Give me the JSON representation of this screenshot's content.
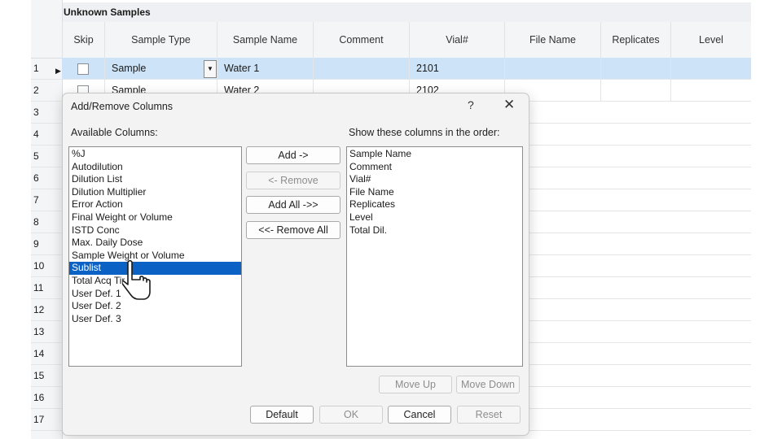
{
  "grid": {
    "title": "Unknown Samples",
    "columns": [
      "Skip",
      "Sample Type",
      "Sample Name",
      "Comment",
      "Vial#",
      "File Name",
      "Replicates",
      "Level"
    ],
    "row_numbers": [
      "1",
      "2",
      "3",
      "4",
      "5",
      "6",
      "7",
      "8",
      "9",
      "10",
      "11",
      "12",
      "13",
      "14",
      "15",
      "16",
      "17"
    ],
    "rows": [
      {
        "sample_type": "Sample",
        "sample_name": "Water 1",
        "vial": "2101"
      },
      {
        "sample_type": "Sample",
        "sample_name": "Water 2",
        "vial": "2102"
      }
    ]
  },
  "dialog": {
    "title": "Add/Remove Columns",
    "help": "?",
    "close": "✕",
    "available_label": "Available Columns:",
    "order_label": "Show these columns in the order:",
    "available_columns": [
      "%J",
      "Autodilution",
      "Dilution List",
      "Dilution Multiplier",
      "Error Action",
      "Final Weight or Volume",
      "ISTD Conc",
      "Max. Daily Dose",
      "Sample Weight or Volume",
      "Sublist",
      "Total Acq Tir",
      "User Def. 1",
      "User Def. 2",
      "User Def. 3"
    ],
    "selected_available": "Sublist",
    "shown_columns": [
      "Sample Name",
      "Comment",
      "Vial#",
      "File Name",
      "Replicates",
      "Level",
      "Total Dil."
    ],
    "buttons": {
      "add": "Add ->",
      "remove": "<- Remove",
      "add_all": "Add All ->>",
      "remove_all": "<<- Remove All",
      "move_up": "Move Up",
      "move_down": "Move Down",
      "default": "Default",
      "ok": "OK",
      "cancel": "Cancel",
      "reset": "Reset"
    }
  },
  "icons": {
    "row_marker": "play-arrow-icon",
    "cursor": "hand-pointer-icon",
    "dropdown": "chevron-down-icon"
  },
  "colors": {
    "selection": "#0b62c4",
    "row_selected": "#cde3f7"
  }
}
